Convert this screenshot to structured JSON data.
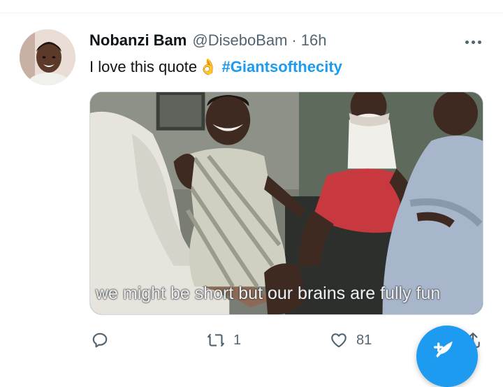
{
  "tweet": {
    "display_name": "Nobanzi Bam",
    "handle": "@DiseboBam",
    "separator": "·",
    "time": "16h",
    "text": "I love this quote",
    "emoji": "👌",
    "hashtag": "#Giantsofthecity",
    "media_subtitle": "we might be short but our brains are fully fun"
  },
  "actions": {
    "reply_icon": "reply-icon",
    "retweet_icon": "retweet-icon",
    "retweet_count": "1",
    "like_icon": "heart-icon",
    "like_count": "81",
    "share_icon": "share-icon"
  },
  "compose_button": {
    "icon": "compose-feather-icon"
  },
  "colors": {
    "accent": "#1d9bf0",
    "text_primary": "#0f1419",
    "text_secondary": "#536471",
    "border": "#cfd9de"
  }
}
